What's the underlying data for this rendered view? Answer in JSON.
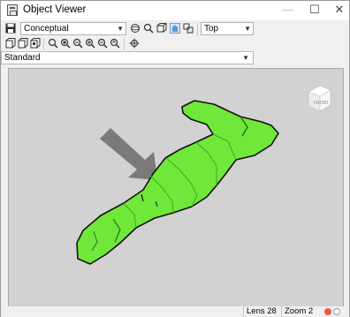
{
  "window": {
    "title": "Object Viewer",
    "minimize_glyph": "—",
    "maximize_glyph": "☐",
    "close_glyph": "✕"
  },
  "toolbar": {
    "visual_style": "Conceptual",
    "view": "Top",
    "icons_row1": [
      "save-icon",
      "orbit-icon",
      "zoom-icon",
      "view-cube-icon",
      "pan-icon",
      "ucs-icon"
    ],
    "icons_row2": [
      "view-icon",
      "view-alt-icon",
      "view-alt2-icon",
      "zoom-realtime-icon",
      "zoom-window-icon",
      "zoom-extents-icon",
      "zoom-in-icon",
      "zoom-out-icon",
      "zoom-previous-icon",
      "crosshair-icon"
    ]
  },
  "preset": {
    "value": "Standard"
  },
  "viewcube": {
    "face_label": "FRONT"
  },
  "status": {
    "lens": "Lens 28",
    "zoom": "Zoom 2",
    "indicator_colors": [
      "#e8584a",
      "#ffffff"
    ]
  },
  "colors": {
    "model_fill": "#6fe83a",
    "model_edge": "#111111",
    "arrow": "#7a7a7a",
    "viewport_bg": "#d2d2d2"
  }
}
